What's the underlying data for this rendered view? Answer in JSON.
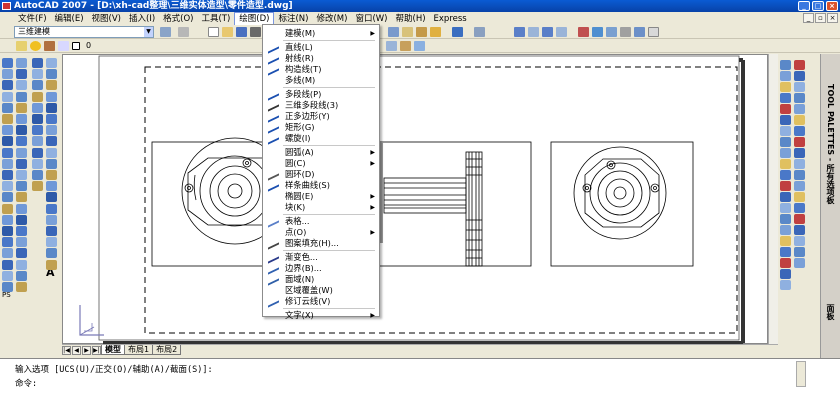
{
  "title": "AutoCAD 2007 - [D:\\xh-cad整理\\三维实体造型\\零件造型.dwg]",
  "menubar": [
    "文件(F)",
    "编辑(E)",
    "视图(V)",
    "插入(I)",
    "格式(O)",
    "工具(T)",
    "绘图(D)",
    "标注(N)",
    "修改(M)",
    "窗口(W)",
    "帮助(H)",
    "Express"
  ],
  "workspace": "三维建模",
  "layer": "0",
  "draw_menu": {
    "items": [
      {
        "label": "建模(M)",
        "icon": "",
        "submenu": true
      },
      {
        "sep": true
      },
      {
        "label": "直线(L)",
        "icon": "line-icon"
      },
      {
        "label": "射线(R)",
        "icon": "ray-icon"
      },
      {
        "label": "构造线(T)",
        "icon": "xline-icon"
      },
      {
        "label": "多线(M)",
        "icon": ""
      },
      {
        "sep": true
      },
      {
        "label": "多段线(P)",
        "icon": "polyline-icon"
      },
      {
        "label": "三维多段线(3)",
        "icon": "3dpoly-icon"
      },
      {
        "label": "正多边形(Y)",
        "icon": "polygon-icon"
      },
      {
        "label": "矩形(G)",
        "icon": "rectangle-icon"
      },
      {
        "label": "螺旋(I)",
        "icon": "helix-icon"
      },
      {
        "sep": true
      },
      {
        "label": "圆弧(A)",
        "icon": "",
        "submenu": true
      },
      {
        "label": "圆(C)",
        "icon": "",
        "submenu": true
      },
      {
        "label": "圆环(D)",
        "icon": "donut-icon"
      },
      {
        "label": "样条曲线(S)",
        "icon": "spline-icon"
      },
      {
        "label": "椭圆(E)",
        "icon": "",
        "submenu": true
      },
      {
        "label": "块(K)",
        "icon": "",
        "submenu": true
      },
      {
        "sep": true
      },
      {
        "label": "表格...",
        "icon": "table-icon"
      },
      {
        "label": "点(O)",
        "icon": "",
        "submenu": true
      },
      {
        "label": "图案填充(H)...",
        "icon": "hatch-icon"
      },
      {
        "sep": true
      },
      {
        "label": "渐变色...",
        "icon": "gradient-icon"
      },
      {
        "label": "边界(B)...",
        "icon": "boundary-icon"
      },
      {
        "label": "面域(N)",
        "icon": "region-icon"
      },
      {
        "label": "区域覆盖(W)",
        "icon": ""
      },
      {
        "label": "修订云线(V)",
        "icon": "revcloud-icon"
      },
      {
        "sep": true
      },
      {
        "label": "文字(X)",
        "icon": "",
        "submenu": true
      }
    ]
  },
  "layout_tabs": [
    "模型",
    "布局1",
    "布局2"
  ],
  "command": {
    "line1": "输入选项 [UCS(U)/正交(O)/辅助(A)/截面(S)]:",
    "line2": "命令:"
  },
  "palette_labels": [
    "TOOL PALETTES - 所有选项板",
    "面板"
  ],
  "colors": {
    "titlebar": "#0a5bd3",
    "menu_highlight": "#7a96df",
    "canvas": "#ffffff"
  }
}
